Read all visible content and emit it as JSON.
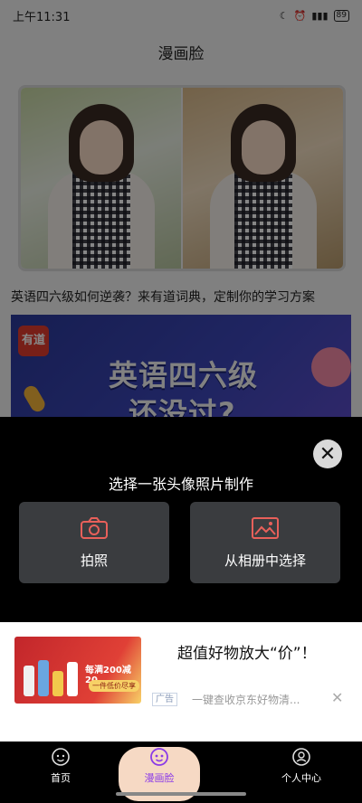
{
  "status_bar": {
    "time": "上午11:31",
    "battery": "89"
  },
  "page": {
    "title": "漫画脸",
    "article_title": "英语四六级如何逆袭？来有道词典，定制你的学习方案",
    "banner": {
      "logo_text": "有道",
      "headline_line1": "英语四六级",
      "headline_line2": "还没过?"
    }
  },
  "sheet": {
    "title": "选择一张头像照片制作",
    "camera_label": "拍照",
    "album_label": "从相册中选择"
  },
  "ad": {
    "title": "超值好物放大“价”！",
    "tag": "广告",
    "description": "一键查收京东好物清...",
    "promo_line1": "每满200减20",
    "promo_line2": "一件低价尽享"
  },
  "tabbar": {
    "tabs": [
      {
        "label": "首页",
        "icon": "home-icon"
      },
      {
        "label": "漫画脸",
        "icon": "comic-face-icon",
        "active": true
      },
      {
        "label": "个人中心",
        "icon": "profile-icon"
      }
    ],
    "active_color": "#8b3be8"
  }
}
